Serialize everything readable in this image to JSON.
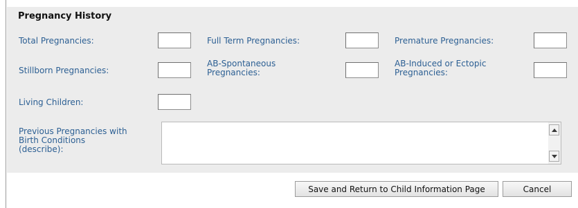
{
  "section": {
    "title": "Pregnancy History"
  },
  "fields": {
    "total_pregnancies": {
      "label": "Total Pregnancies:",
      "value": ""
    },
    "full_term_pregnancies": {
      "label": "Full Term Pregnancies:",
      "value": ""
    },
    "premature_pregnancies": {
      "label": "Premature Pregnancies:",
      "value": ""
    },
    "stillborn_pregnancies": {
      "label": "Stillborn Pregnancies:",
      "value": ""
    },
    "ab_spontaneous_pregnancies": {
      "label_line1": "AB-Spontaneous",
      "label_line2": "Pregnancies:",
      "value": ""
    },
    "ab_induced_ectopic_pregnancies": {
      "label_line1": "AB-Induced or Ectopic",
      "label_line2": "Pregnancies:",
      "value": ""
    },
    "living_children": {
      "label": "Living Children:",
      "value": ""
    },
    "previous_pregnancies_conditions": {
      "label_line1": "Previous Pregnancies with",
      "label_line2": "Birth Conditions",
      "label_line3": "(describe):",
      "value": ""
    }
  },
  "buttons": {
    "save_return": "Save and Return to Child Information Page",
    "cancel": "Cancel"
  },
  "icons": {
    "scroll_up": "scroll-up-arrow-icon",
    "scroll_down": "scroll-down-arrow-icon"
  },
  "colors": {
    "label": "#2c5f93",
    "panel_background": "#ececec"
  }
}
